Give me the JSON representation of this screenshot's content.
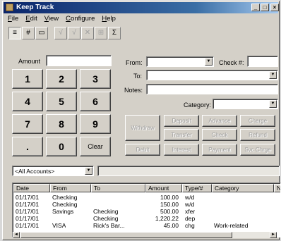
{
  "window": {
    "title": "Keep Track"
  },
  "titlebar_buttons": {
    "minimize": "_",
    "maximize": "□",
    "close": "×"
  },
  "menu": [
    "File",
    "Edit",
    "View",
    "Configure",
    "Help"
  ],
  "toolbar": {
    "icons": [
      "entry-form-icon",
      "register-grid-icon",
      "accounts-icon",
      "check-icon",
      "check-icon",
      "delete-icon",
      "split-icon",
      "sum-icon"
    ],
    "glyphs": [
      "≡",
      "#",
      "▭",
      "√",
      "√",
      "✕",
      "⊞",
      "Σ"
    ]
  },
  "amount": {
    "label": "Amount",
    "value": ""
  },
  "keypad": [
    "1",
    "2",
    "3",
    "4",
    "5",
    "6",
    "7",
    "8",
    "9",
    ".",
    "0",
    "Clear"
  ],
  "form": {
    "from_label": "From:",
    "from_value": "",
    "check_label": "Check #:",
    "check_value": "",
    "to_label": "To:",
    "to_value": "",
    "notes_label": "Notes:",
    "notes_value": "",
    "category_label": "Category:",
    "category_value": ""
  },
  "actions": {
    "withdraw": "Withdraw",
    "deposit": "Deposit",
    "advance": "Advance",
    "charge": "Charge",
    "transfer": "Transfer",
    "check": "Check",
    "refund": "Refund",
    "debit": "Debit",
    "interest": "Interest",
    "payment": "Payment",
    "svc_chrg": "Svc Chrge"
  },
  "account_filter": {
    "value": "<All Accounts>"
  },
  "register": {
    "columns": [
      "Date",
      "From",
      "To",
      "Amount",
      "Type/#",
      "Category",
      "N"
    ],
    "rows": [
      {
        "date": "01/17/01",
        "from": "Checking",
        "to": "",
        "amount": "100.00",
        "type": "w/d",
        "category": ""
      },
      {
        "date": "01/17/01",
        "from": "Checking",
        "to": "",
        "amount": "150.00",
        "type": "w/d",
        "category": ""
      },
      {
        "date": "01/17/01",
        "from": "Savings",
        "to": "Checking",
        "amount": "500.00",
        "type": "xfer",
        "category": ""
      },
      {
        "date": "01/17/01",
        "from": "",
        "to": "Checking",
        "amount": "1,220.22",
        "type": "dep",
        "category": ""
      },
      {
        "date": "01/17/01",
        "from": "VISA",
        "to": "Rick's Bar...",
        "amount": "45.00",
        "type": "chg",
        "category": "Work-related"
      }
    ]
  }
}
